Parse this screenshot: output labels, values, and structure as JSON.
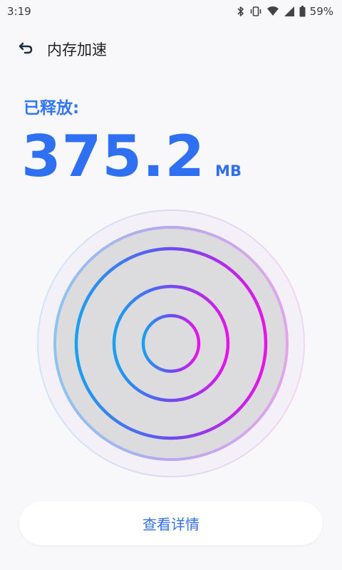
{
  "status_bar": {
    "time": "3:19",
    "battery": "59%",
    "icons": [
      "bluetooth-icon",
      "vibrate-icon",
      "wifi-icon",
      "signal-icon",
      "battery-icon"
    ]
  },
  "header": {
    "back_icon": "back-arrow-icon",
    "title": "内存加速"
  },
  "released": {
    "label": "已释放:",
    "value": "375.2",
    "unit": "MB"
  },
  "rings": {
    "gradient_start": "#1aa0f0",
    "gradient_end": "#e714e8",
    "center_fill": "#dcdcde"
  },
  "detail_button": {
    "label": "查看详情"
  },
  "colors": {
    "accent": "#2f6ff1",
    "background": "#f8f8fa"
  }
}
